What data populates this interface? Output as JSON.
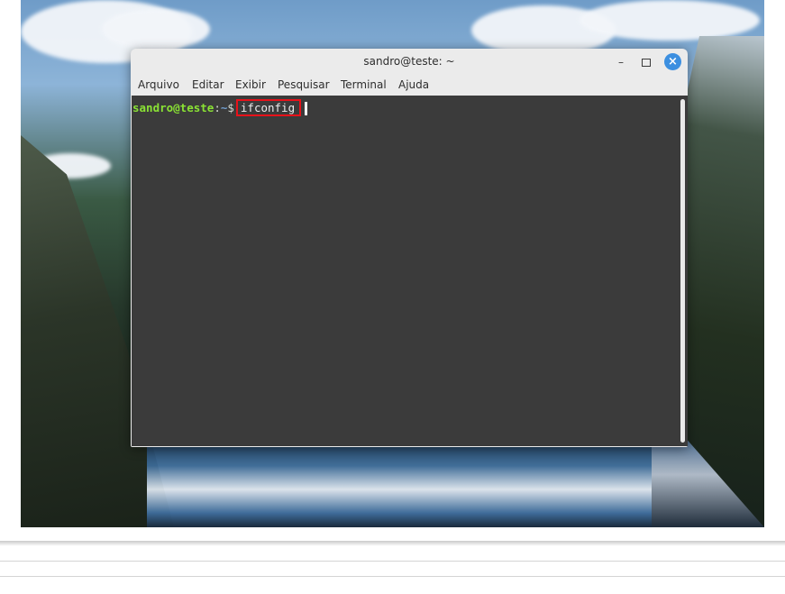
{
  "window": {
    "title": "sandro@teste: ~",
    "controls": {
      "minimize": "–",
      "close": "×"
    }
  },
  "menubar": {
    "items": [
      "Arquivo",
      "Editar",
      "Exibir",
      "Pesquisar",
      "Terminal",
      "Ajuda"
    ]
  },
  "terminal": {
    "prompt_user": "sandro@teste",
    "prompt_separator": ":",
    "prompt_path": "~",
    "prompt_sign": "$",
    "command": "ifconfig"
  },
  "colors": {
    "terminal_bg": "#3b3b3b",
    "prompt_user": "#8ae234",
    "prompt_path": "#729fcf",
    "highlight_box": "#e8121a",
    "close_button": "#3c8fe0"
  }
}
